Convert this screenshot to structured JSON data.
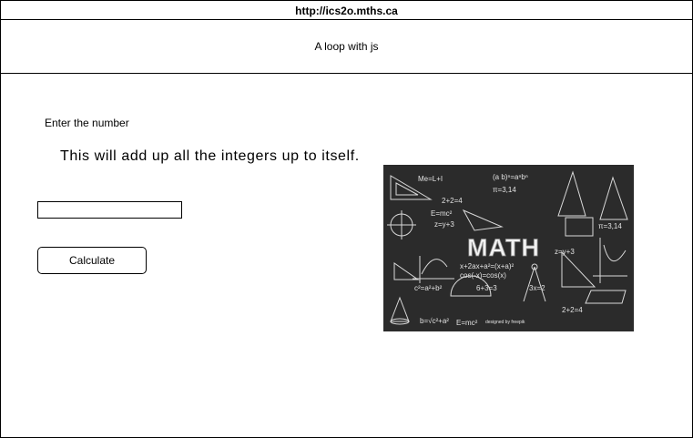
{
  "browser": {
    "url": "http://ics2o.mths.ca"
  },
  "header": {
    "title": "A loop with js"
  },
  "main": {
    "prompt_label": "Enter the number",
    "description": "This will add up all the integers up to itself.",
    "number_input": {
      "value": "",
      "placeholder": ""
    },
    "calculate_button_label": "Calculate"
  },
  "chalkboard_image": {
    "word": "MATH",
    "formulas": [
      "Me=L+I",
      "(a b)ⁿ=aⁿbⁿ",
      "π=3,14",
      "2+2=4",
      "E=mc²",
      "z=y+3",
      "x+2ax+a²=(x+a)²",
      "cos(-x)=cos(x)",
      "c²=a²+b²",
      "6+3=3",
      "3x=2",
      "π=3,14",
      "z=y+3",
      "E=mc²",
      "2+2=4",
      "b=√c²+a²",
      "designed by freepik"
    ],
    "colors": {
      "board": "#2a2a2a",
      "chalk": "#e8e8e8"
    }
  }
}
